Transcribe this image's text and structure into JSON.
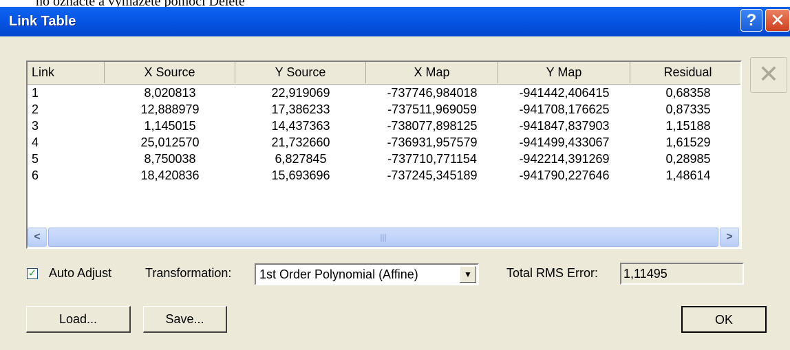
{
  "document_text": "no označte a vymažete pomocí Delete",
  "window": {
    "title": "Link Table",
    "help_label": "?",
    "close_label": "✕"
  },
  "delete_icon": "close-x-icon (disabled)",
  "table": {
    "columns": [
      "Link",
      "X Source",
      "Y Source",
      "X Map",
      "Y Map",
      "Residual"
    ],
    "rows": [
      [
        "1",
        "8,020813",
        "22,919069",
        "-737746,984018",
        "-941442,406415",
        "0,68358"
      ],
      [
        "2",
        "12,888979",
        "17,386233",
        "-737511,969059",
        "-941708,176625",
        "0,87335"
      ],
      [
        "3",
        "1,145015",
        "14,437363",
        "-738077,898125",
        "-941847,837903",
        "1,15188"
      ],
      [
        "4",
        "25,012570",
        "21,732660",
        "-736931,957579",
        "-941499,433067",
        "1,61529"
      ],
      [
        "5",
        "8,750038",
        "6,827845",
        "-737710,771154",
        "-942214,391269",
        "0,28985"
      ],
      [
        "6",
        "18,420836",
        "15,693696",
        "-737245,345189",
        "-941790,227646",
        "1,48614"
      ]
    ]
  },
  "options": {
    "auto_adjust_label": "Auto Adjust",
    "auto_adjust_checked": true,
    "transformation_label": "Transformation:",
    "transformation_value": "1st Order Polynomial (Affine)",
    "rms_label": "Total RMS Error:",
    "rms_value": "1,11495"
  },
  "buttons": {
    "load": "Load...",
    "save": "Save...",
    "ok": "OK"
  },
  "colors": {
    "title_bar": "#0552e0",
    "dialog_bg": "#ece9d8",
    "close_button": "#cf4020"
  }
}
